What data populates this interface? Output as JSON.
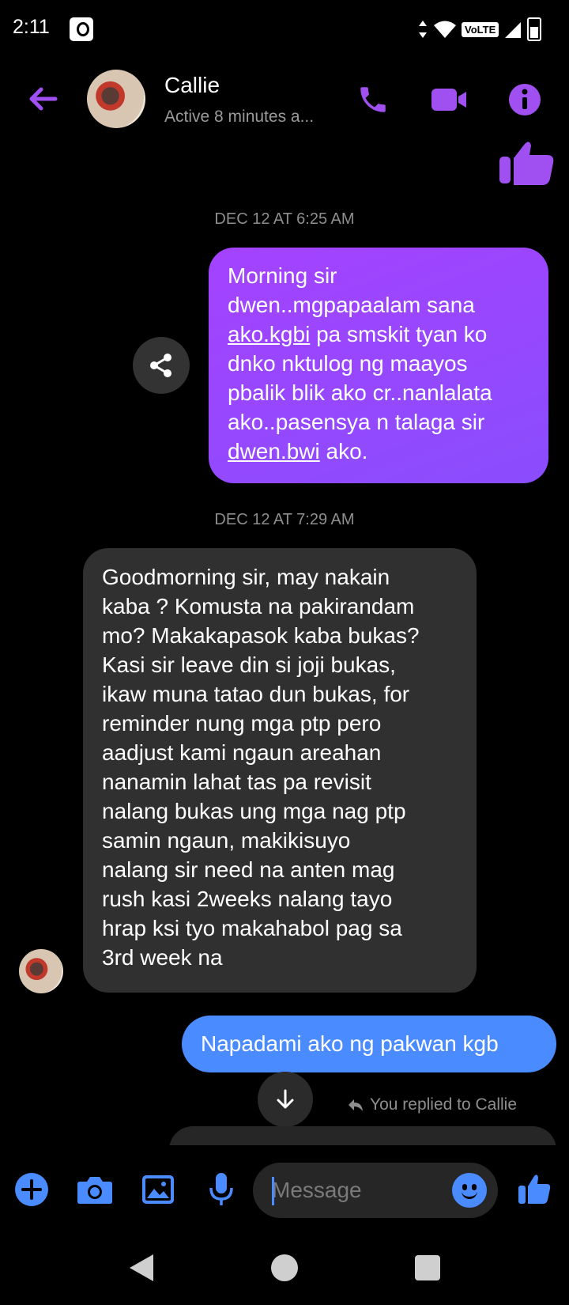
{
  "status_bar": {
    "time": "2:11",
    "network": "VoLTE"
  },
  "header": {
    "name": "Callie",
    "active_status": "Active 8 minutes a...",
    "accent_color": "#a050f0"
  },
  "conversation": {
    "timestamp_1": "DEC 12 AT 6:25 AM",
    "outgoing_1": {
      "line1": "Morning sir",
      "line2": "dwen..mgpapaalam sana",
      "line3_link": "ako.kgbi",
      "line3_rest": " pa smskit tyan ko",
      "line4": "dnko nktulog ng maayos",
      "line5": "pbalik blik ako cr..nanlalata",
      "line6": "ako..pasensya n talaga sir",
      "line7_link": "dwen.bwi",
      "line7_rest": " ako."
    },
    "timestamp_2": "DEC 12 AT 7:29 AM",
    "incoming_1": {
      "lines": [
        "Goodmorning sir, may nakain",
        "kaba ? Komusta na pakirandam",
        "mo? Makakapasok kaba bukas?",
        "Kasi sir leave din si joji bukas,",
        "ikaw muna tatao dun bukas, for",
        "reminder nung mga ptp pero",
        "aadjust kami ngaun areahan",
        "nanamin lahat tas pa revisit",
        "nalang bukas ung mga nag ptp",
        "samin ngaun, makikisuyo",
        "nalang sir need na anten mag",
        "rush kasi 2weeks nalang tayo",
        "hrap ksi tyo makahabol pag sa",
        "3rd week na"
      ]
    },
    "outgoing_2": "Napadami ako ng pakwan kgb",
    "reply_note": "You replied to Callie"
  },
  "composer": {
    "placeholder": "Message"
  },
  "colors": {
    "outgoing_purple": "#9b47fe",
    "outgoing_blue": "#4a8cff",
    "incoming_gray": "#303030",
    "icon_blue": "#4a8cff"
  }
}
